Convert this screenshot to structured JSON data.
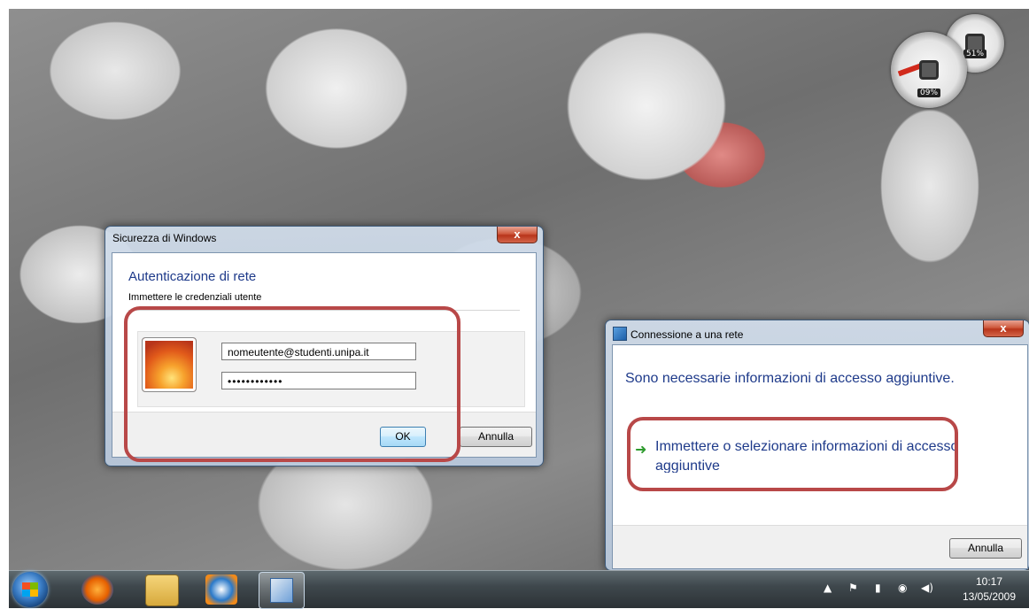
{
  "security_dialog": {
    "title": "Sicurezza di Windows",
    "close_label": "x",
    "heading": "Autenticazione di rete",
    "subheading": "Immettere le credenziali utente",
    "username_value": "nomeutente@studenti.unipa.it",
    "password_value": "••••••••••••",
    "ok_label": "OK",
    "cancel_label": "Annulla"
  },
  "connection_dialog": {
    "title": "Connessione a una rete",
    "close_label": "x",
    "message": "Sono necessarie informazioni di accesso aggiuntive.",
    "link_label": "Immettere o selezionare informazioni di accesso aggiuntive",
    "cancel_label": "Annulla"
  },
  "gadget": {
    "cpu_percent": "09%",
    "memory_percent": "51%"
  },
  "taskbar": {
    "time": "10:17",
    "date": "13/05/2009"
  },
  "icons": {
    "start": "windows-start-orb",
    "firefox": "firefox-icon",
    "explorer": "folder-icon",
    "media_player": "media-player-icon",
    "control_panel": "control-panel-icon"
  },
  "colors": {
    "highlight": "#b84848",
    "heading_blue": "#1e3a8a",
    "arrow_green": "#2e9b2e"
  }
}
